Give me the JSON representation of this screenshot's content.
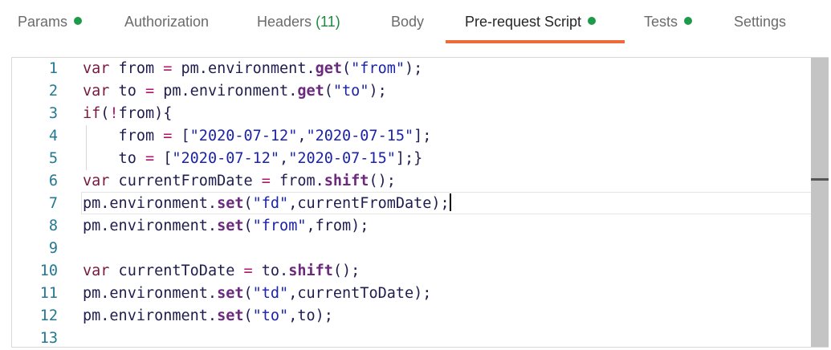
{
  "tabs": [
    {
      "label": "Params",
      "dot": true
    },
    {
      "label": "Authorization"
    },
    {
      "label": "Headers",
      "count": "(11)"
    },
    {
      "label": "Body"
    },
    {
      "label": "Pre-request Script",
      "dot": true,
      "active": true
    },
    {
      "label": "Tests",
      "dot": true
    },
    {
      "label": "Settings"
    }
  ],
  "colors": {
    "accent": "#ef6a3b",
    "status_dot": "#1e9a4a"
  },
  "editor": {
    "cursor_line": 7,
    "lines": [
      [
        [
          "kw",
          "var"
        ],
        [
          "id",
          " from "
        ],
        [
          "op",
          "="
        ],
        [
          "id",
          " pm.environment."
        ],
        [
          "fn",
          "get"
        ],
        [
          "id",
          "("
        ],
        [
          "str",
          "\"from\""
        ],
        [
          "id",
          ");"
        ]
      ],
      [
        [
          "kw",
          "var"
        ],
        [
          "id",
          " to "
        ],
        [
          "op",
          "="
        ],
        [
          "id",
          " pm.environment."
        ],
        [
          "fn",
          "get"
        ],
        [
          "id",
          "("
        ],
        [
          "str",
          "\"to\""
        ],
        [
          "id",
          ");"
        ]
      ],
      [
        [
          "kw",
          "if"
        ],
        [
          "id",
          "("
        ],
        [
          "op",
          "!"
        ],
        [
          "id",
          "from){"
        ]
      ],
      [
        [
          "id",
          "    from "
        ],
        [
          "op",
          "="
        ],
        [
          "id",
          " ["
        ],
        [
          "str",
          "\"2020-07-12\""
        ],
        [
          "id",
          ","
        ],
        [
          "str",
          "\"2020-07-15\""
        ],
        [
          "id",
          "];"
        ]
      ],
      [
        [
          "id",
          "    to "
        ],
        [
          "op",
          "="
        ],
        [
          "id",
          " ["
        ],
        [
          "str",
          "\"2020-07-12\""
        ],
        [
          "id",
          ","
        ],
        [
          "str",
          "\"2020-07-15\""
        ],
        [
          "id",
          "];}"
        ]
      ],
      [
        [
          "kw",
          "var"
        ],
        [
          "id",
          " currentFromDate "
        ],
        [
          "op",
          "="
        ],
        [
          "id",
          " from."
        ],
        [
          "fn",
          "shift"
        ],
        [
          "id",
          "();"
        ]
      ],
      [
        [
          "id",
          "pm.environment."
        ],
        [
          "fn",
          "set"
        ],
        [
          "id",
          "("
        ],
        [
          "str",
          "\"fd\""
        ],
        [
          "id",
          ",currentFromDate);"
        ]
      ],
      [
        [
          "id",
          "pm.environment."
        ],
        [
          "fn",
          "set"
        ],
        [
          "id",
          "("
        ],
        [
          "str",
          "\"from\""
        ],
        [
          "id",
          ",from);"
        ]
      ],
      [],
      [
        [
          "kw",
          "var"
        ],
        [
          "id",
          " currentToDate "
        ],
        [
          "op",
          "="
        ],
        [
          "id",
          " to."
        ],
        [
          "fn",
          "shift"
        ],
        [
          "id",
          "();"
        ]
      ],
      [
        [
          "id",
          "pm.environment."
        ],
        [
          "fn",
          "set"
        ],
        [
          "id",
          "("
        ],
        [
          "str",
          "\"td\""
        ],
        [
          "id",
          ",currentToDate);"
        ]
      ],
      [
        [
          "id",
          "pm.environment."
        ],
        [
          "fn",
          "set"
        ],
        [
          "id",
          "("
        ],
        [
          "str",
          "\"to\""
        ],
        [
          "id",
          ",to);"
        ]
      ],
      []
    ]
  }
}
